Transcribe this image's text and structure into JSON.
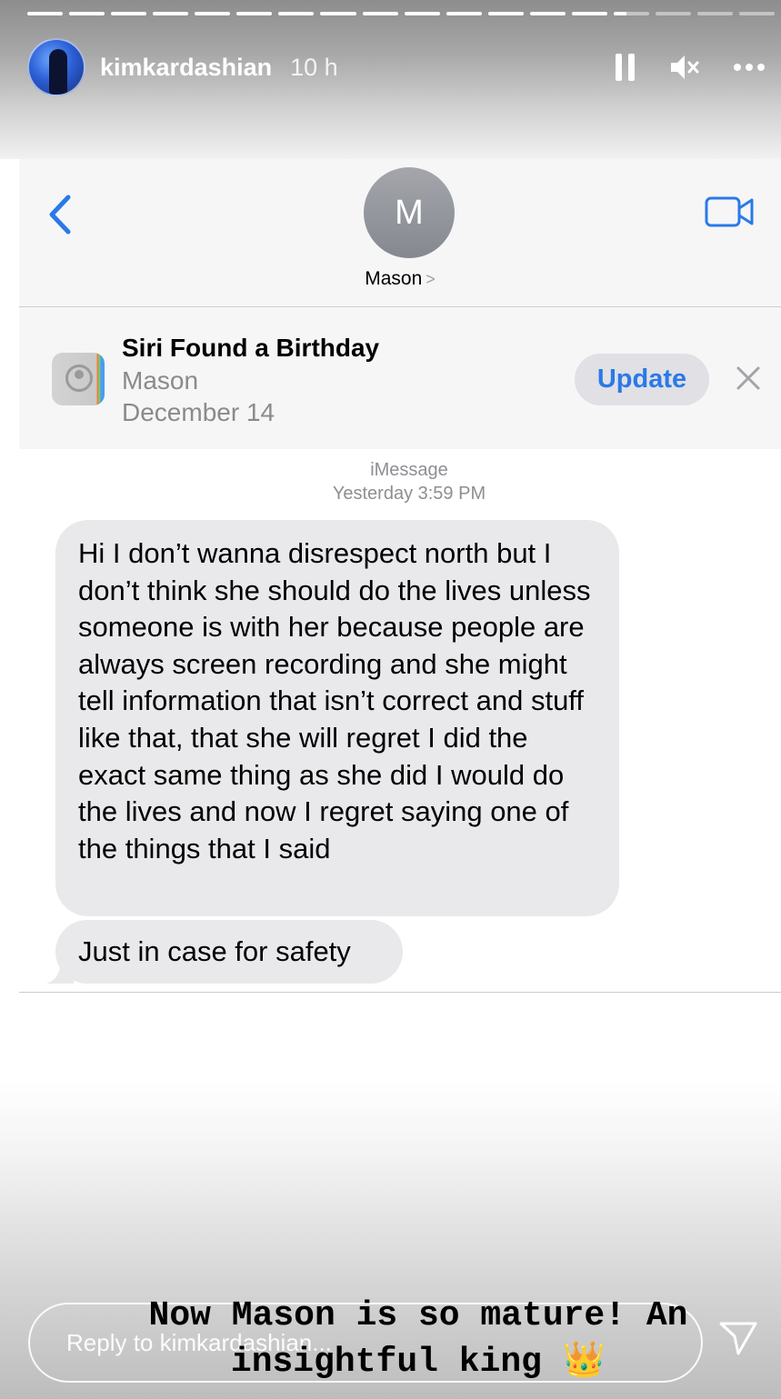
{
  "story": {
    "username": "kimkardashian",
    "time_ago": "10 h",
    "progress_segments": 18,
    "completed_segments": 14,
    "current_segment_fraction": 0.35,
    "caption_line1": "Now Mason is so mature! An",
    "caption_line2": "insightful king",
    "caption_emoji": "👑",
    "reply_placeholder": "Reply to kimkardashian..."
  },
  "icons": {
    "pause": "pause-icon",
    "mute": "mute-icon",
    "more": "more-icon",
    "send": "send-icon"
  },
  "messages_app": {
    "contact_initial": "M",
    "contact_name": "Mason",
    "contact_chevron": ">",
    "siri": {
      "title": "Siri Found a Birthday",
      "name": "Mason",
      "date": "December 14",
      "update_label": "Update"
    },
    "service_label": "iMessage",
    "timestamp": "Yesterday 3:59 PM",
    "messages": [
      {
        "from": "Mason",
        "text": "Hi I don’t wanna disrespect north but I don’t think she should do the lives unless someone is with her because people are always screen recording and she might tell information that isn’t correct and stuff like that, that she will regret I did the exact same thing as she did I would do the lives and now I regret saying one of the things that I said"
      },
      {
        "from": "Mason",
        "text": "Just in case for safety"
      }
    ]
  },
  "colors": {
    "ios_blue": "#2a79e8",
    "bubble_gray": "#e9e9eb",
    "secondary_text": "#8a8a8e"
  }
}
